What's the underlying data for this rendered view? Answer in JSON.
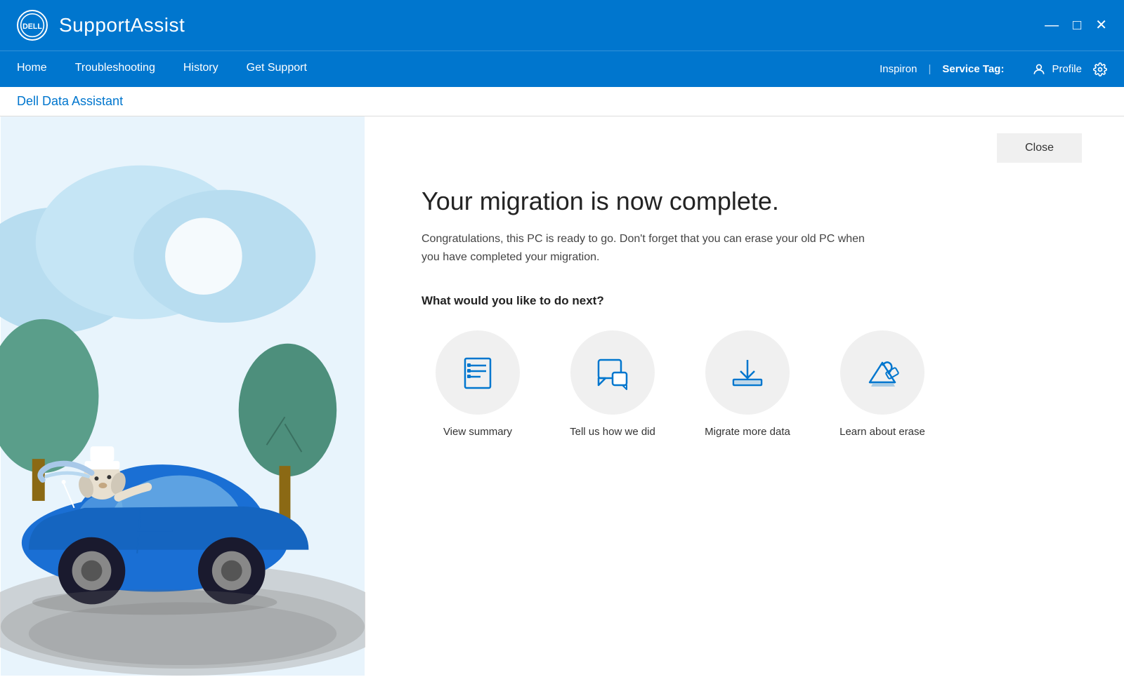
{
  "titlebar": {
    "logo": "DELL",
    "app_name": "SupportAssist",
    "controls": {
      "minimize": "—",
      "maximize": "□",
      "close": "✕"
    }
  },
  "navbar": {
    "links": [
      "Home",
      "Troubleshooting",
      "History",
      "Get Support"
    ],
    "device": "Inspiron",
    "separator": "|",
    "service_tag_label": "Service Tag:",
    "service_tag_value": "",
    "profile_label": "Profile"
  },
  "subheader": {
    "title": "Dell Data Assistant"
  },
  "main": {
    "close_button": "Close",
    "heading": "Your migration is now complete.",
    "description": "Congratulations, this PC is ready to go. Don't forget that you can erase your old PC when you have completed your migration.",
    "next_question": "What would you like to do next?",
    "actions": [
      {
        "id": "view-summary",
        "label": "View summary",
        "icon": "list-icon"
      },
      {
        "id": "tell-us",
        "label": "Tell us how we did",
        "icon": "feedback-icon"
      },
      {
        "id": "migrate-more",
        "label": "Migrate more data",
        "icon": "download-icon"
      },
      {
        "id": "learn-erase",
        "label": "Learn about erase",
        "icon": "erase-icon"
      }
    ]
  }
}
